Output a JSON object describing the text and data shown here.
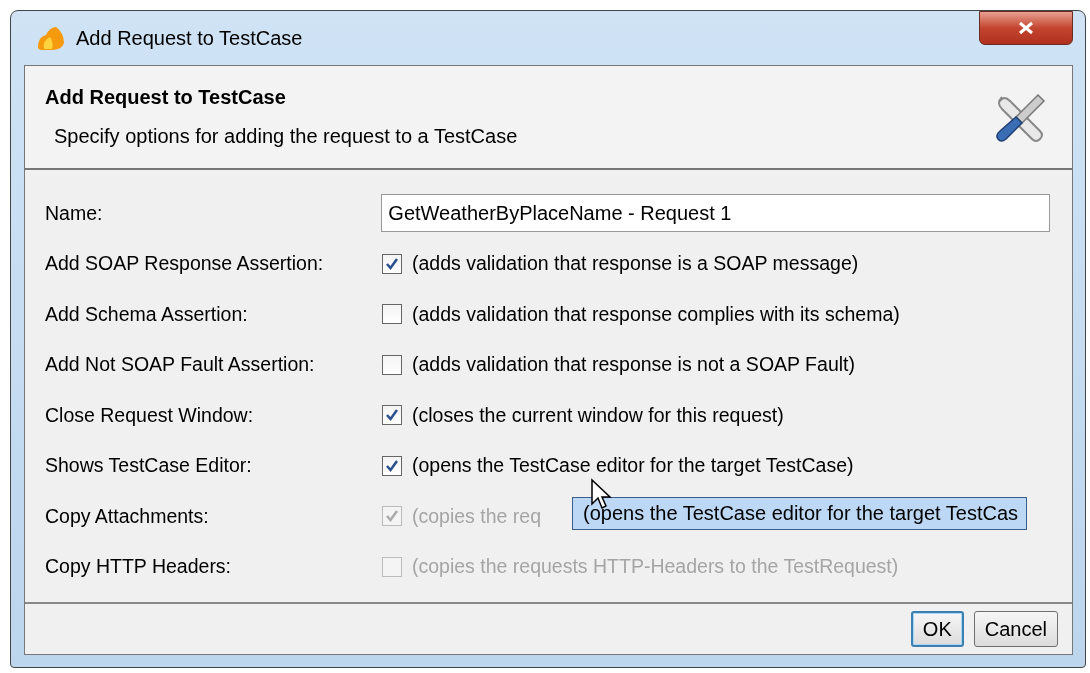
{
  "window": {
    "title": "Add Request to TestCase"
  },
  "header": {
    "title": "Add Request to TestCase",
    "description": "Specify options for adding the request to a TestCase"
  },
  "fields": [
    {
      "kind": "text",
      "label": "Name:",
      "value": "GetWeatherByPlaceName - Request 1"
    },
    {
      "kind": "checkbox",
      "label": "Add SOAP Response Assertion:",
      "checked": true,
      "disabled": false,
      "description": "(adds validation that response is a SOAP message)"
    },
    {
      "kind": "checkbox",
      "label": "Add Schema Assertion:",
      "checked": false,
      "disabled": false,
      "description": "(adds validation that response complies with its schema)"
    },
    {
      "kind": "checkbox",
      "label": "Add Not SOAP Fault Assertion:",
      "checked": false,
      "disabled": false,
      "description": "(adds validation that response is not a SOAP Fault)"
    },
    {
      "kind": "checkbox",
      "label": "Close Request Window:",
      "checked": true,
      "disabled": false,
      "description": "(closes the current window for this request)"
    },
    {
      "kind": "checkbox",
      "label": "Shows TestCase Editor:",
      "checked": true,
      "disabled": false,
      "description": "(opens the TestCase editor for the target TestCase)"
    },
    {
      "kind": "checkbox",
      "label": "Copy Attachments:",
      "checked": true,
      "disabled": true,
      "description": "(copies the req"
    },
    {
      "kind": "checkbox",
      "label": "Copy HTTP Headers:",
      "checked": false,
      "disabled": true,
      "description": "(copies the requests HTTP-Headers to the TestRequest)"
    }
  ],
  "tooltip": {
    "text": "(opens the TestCase editor for the target TestCas"
  },
  "buttons": [
    {
      "label": "OK",
      "default": true
    },
    {
      "label": "Cancel",
      "default": false
    }
  ]
}
